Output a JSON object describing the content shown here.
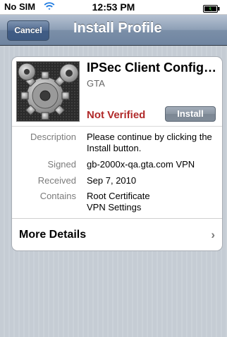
{
  "status_bar": {
    "carrier": "No SIM",
    "time": "12:53 PM",
    "wifi_icon": "wifi-icon",
    "battery_icon": "battery-icon"
  },
  "navbar": {
    "cancel_label": "Cancel",
    "title": "Install Profile"
  },
  "profile": {
    "name": "IPSec Client Config…",
    "organization": "GTA",
    "icon": "settings-gear-icon",
    "verification_status": "Not Verified",
    "install_label": "Install"
  },
  "details": [
    {
      "key": "Description",
      "value": "Please continue by clicking the Install button."
    },
    {
      "key": "Signed",
      "value": "gb-2000x-qa.gta.com VPN"
    },
    {
      "key": "Received",
      "value": "Sep 7, 2010"
    },
    {
      "key": "Contains",
      "value": "Root Certificate\nVPN Settings"
    }
  ],
  "more_details": {
    "label": "More Details",
    "chevron_icon": "chevron-right-icon"
  },
  "colors": {
    "nav_blue": "#6f84a0",
    "not_verified_red": "#b12a2a",
    "background": "#c5ccd4"
  }
}
